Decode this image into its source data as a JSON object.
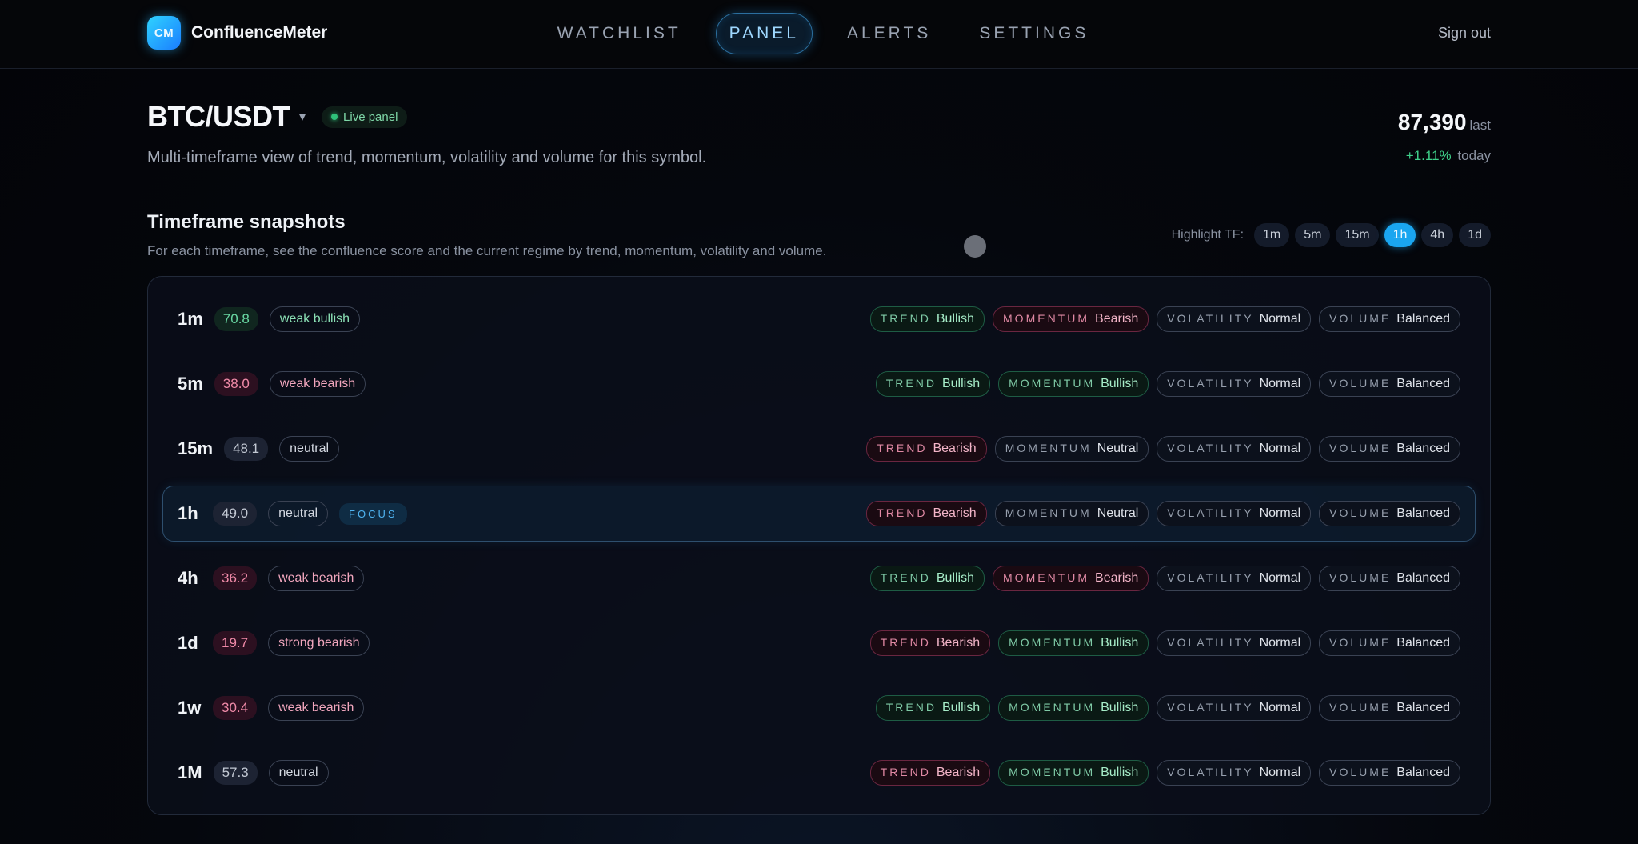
{
  "app": {
    "logo_text": "CM",
    "name": "ConfluenceMeter"
  },
  "nav": [
    {
      "label": "WATCHLIST",
      "active": false
    },
    {
      "label": "PANEL",
      "active": true
    },
    {
      "label": "ALERTS",
      "active": false
    },
    {
      "label": "SETTINGS",
      "active": false
    }
  ],
  "signout": "Sign out",
  "header": {
    "symbol": "BTC/USDT",
    "caret": "▾",
    "live_label": "Live panel",
    "subtitle": "Multi-timeframe view of trend, momentum, volatility and volume for this symbol.",
    "price": "87,390",
    "price_unit": "last",
    "change_pct": "+1.11%",
    "change_label": "today"
  },
  "section": {
    "title": "Timeframe snapshots",
    "description": "For each timeframe, see the confluence score and the current regime by trend, momentum, volatility and volume.",
    "highlight_label": "Highlight TF:",
    "highlight_options": [
      "1m",
      "5m",
      "15m",
      "1h",
      "4h",
      "1d"
    ],
    "highlight_selected": "1h"
  },
  "focus_tag": "FOCUS",
  "metric_labels": {
    "trend": "TREND",
    "momentum": "MOMENTUM",
    "volatility": "VOLATILITY",
    "volume": "VOLUME"
  },
  "rows": [
    {
      "tf": "1m",
      "score": "70.8",
      "score_tone": "bull",
      "regime": "weak bullish",
      "regime_tone": "bull",
      "focus": false,
      "trend": "Bullish",
      "momentum": "Bearish",
      "volatility": "Normal",
      "volume": "Balanced"
    },
    {
      "tf": "5m",
      "score": "38.0",
      "score_tone": "bear",
      "regime": "weak bearish",
      "regime_tone": "bear",
      "focus": false,
      "trend": "Bullish",
      "momentum": "Bullish",
      "volatility": "Normal",
      "volume": "Balanced"
    },
    {
      "tf": "15m",
      "score": "48.1",
      "score_tone": "neu",
      "regime": "neutral",
      "regime_tone": "neu",
      "focus": false,
      "trend": "Bearish",
      "momentum": "Neutral",
      "volatility": "Normal",
      "volume": "Balanced"
    },
    {
      "tf": "1h",
      "score": "49.0",
      "score_tone": "neu",
      "regime": "neutral",
      "regime_tone": "neu",
      "focus": true,
      "trend": "Bearish",
      "momentum": "Neutral",
      "volatility": "Normal",
      "volume": "Balanced"
    },
    {
      "tf": "4h",
      "score": "36.2",
      "score_tone": "bear",
      "regime": "weak bearish",
      "regime_tone": "bear",
      "focus": false,
      "trend": "Bullish",
      "momentum": "Bearish",
      "volatility": "Normal",
      "volume": "Balanced"
    },
    {
      "tf": "1d",
      "score": "19.7",
      "score_tone": "bear",
      "regime": "strong bearish",
      "regime_tone": "bear",
      "focus": false,
      "trend": "Bearish",
      "momentum": "Bullish",
      "volatility": "Normal",
      "volume": "Balanced"
    },
    {
      "tf": "1w",
      "score": "30.4",
      "score_tone": "bear",
      "regime": "weak bearish",
      "regime_tone": "bear",
      "focus": false,
      "trend": "Bullish",
      "momentum": "Bullish",
      "volatility": "Normal",
      "volume": "Balanced"
    },
    {
      "tf": "1M",
      "score": "57.3",
      "score_tone": "neu",
      "regime": "neutral",
      "regime_tone": "neu",
      "focus": false,
      "trend": "Bearish",
      "momentum": "Bullish",
      "volatility": "Normal",
      "volume": "Balanced"
    }
  ]
}
